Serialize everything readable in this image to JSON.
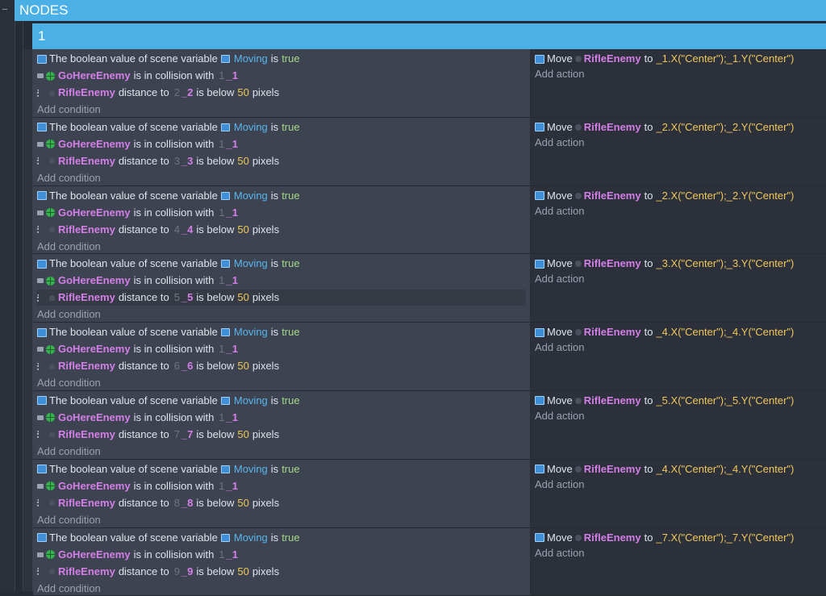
{
  "header": {
    "title": "NODES"
  },
  "group": {
    "title": "1"
  },
  "labels": {
    "cond1_prefix": "The boolean value of scene variable",
    "is": "is",
    "collision": "is in collision with",
    "distance_to": "distance to",
    "is_below": "is below",
    "pixels": "pixels",
    "move": "Move",
    "to": "to",
    "add_condition": "Add condition",
    "add_action": "Add action"
  },
  "icons": {
    "variable": "scene-variable-icon",
    "collision": "collision-icon",
    "distance": "distance-icon",
    "move": "move-icon"
  },
  "colors": {
    "accent": "#4ab0e6",
    "object": "#d47fe8",
    "variable": "#58b6ee",
    "boolean": "#a3d98a",
    "number": "#f0c85a"
  },
  "events": [
    {
      "var": "Moving",
      "val": "true",
      "obj1": "GoHereEnemy",
      "ghost1": "1",
      "tgt1": "_1",
      "obj2": "RifleEnemy",
      "ghost2": "2",
      "tgt2": "_2",
      "dist": "50",
      "actObj": "RifleEnemy",
      "actExpr": "_1.X(\"Center\");_1.Y(\"Center\")"
    },
    {
      "var": "Moving",
      "val": "true",
      "obj1": "GoHereEnemy",
      "ghost1": "1",
      "tgt1": "_1",
      "obj2": "RifleEnemy",
      "ghost2": "3",
      "tgt2": "_3",
      "dist": "50",
      "actObj": "RifleEnemy",
      "actExpr": "_2.X(\"Center\");_2.Y(\"Center\")"
    },
    {
      "var": "Moving",
      "val": "true",
      "obj1": "GoHereEnemy",
      "ghost1": "1",
      "tgt1": "_1",
      "obj2": "RifleEnemy",
      "ghost2": "4",
      "tgt2": "_4",
      "dist": "50",
      "actObj": "RifleEnemy",
      "actExpr": "_2.X(\"Center\");_2.Y(\"Center\")"
    },
    {
      "var": "Moving",
      "val": "true",
      "obj1": "GoHereEnemy",
      "ghost1": "1",
      "tgt1": "_1",
      "obj2": "RifleEnemy",
      "ghost2": "5",
      "tgt2": "_5",
      "dist": "50",
      "actObj": "RifleEnemy",
      "actExpr": "_3.X(\"Center\");_3.Y(\"Center\")"
    },
    {
      "var": "Moving",
      "val": "true",
      "obj1": "GoHereEnemy",
      "ghost1": "1",
      "tgt1": "_1",
      "obj2": "RifleEnemy",
      "ghost2": "6",
      "tgt2": "_6",
      "dist": "50",
      "actObj": "RifleEnemy",
      "actExpr": "_4.X(\"Center\");_4.Y(\"Center\")"
    },
    {
      "var": "Moving",
      "val": "true",
      "obj1": "GoHereEnemy",
      "ghost1": "1",
      "tgt1": "_1",
      "obj2": "RifleEnemy",
      "ghost2": "7",
      "tgt2": "_7",
      "dist": "50",
      "actObj": "RifleEnemy",
      "actExpr": "_5.X(\"Center\");_5.Y(\"Center\")"
    },
    {
      "var": "Moving",
      "val": "true",
      "obj1": "GoHereEnemy",
      "ghost1": "1",
      "tgt1": "_1",
      "obj2": "RifleEnemy",
      "ghost2": "8",
      "tgt2": "_8",
      "dist": "50",
      "actObj": "RifleEnemy",
      "actExpr": "_4.X(\"Center\");_4.Y(\"Center\")"
    },
    {
      "var": "Moving",
      "val": "true",
      "obj1": "GoHereEnemy",
      "ghost1": "1",
      "tgt1": "_1",
      "obj2": "RifleEnemy",
      "ghost2": "9",
      "tgt2": "_9",
      "dist": "50",
      "actObj": "RifleEnemy",
      "actExpr": "_7.X(\"Center\");_7.Y(\"Center\")"
    }
  ]
}
